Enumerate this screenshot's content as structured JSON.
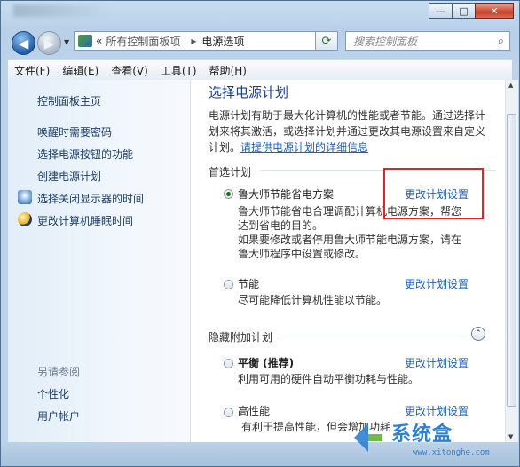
{
  "window": {
    "caption_minimize": "—",
    "caption_maximize": "□",
    "caption_close": "✕"
  },
  "nav": {
    "back_glyph": "◀",
    "forward_glyph": "▶",
    "history_glyph": "▼",
    "address": {
      "sep": "«",
      "crumb1": "所有控制面板项",
      "arrow": "▸",
      "crumb2": "电源选项",
      "dropdown_glyph": "▼"
    },
    "refresh_glyph": "⟳",
    "search_placeholder": "搜索控制面板",
    "search_icon_glyph": "⌕"
  },
  "menu": [
    "文件(F)",
    "编辑(E)",
    "查看(V)",
    "工具(T)",
    "帮助(H)"
  ],
  "sidebar": {
    "home": "控制面板主页",
    "links": [
      "唤醒时需要密码",
      "选择电源按钮的功能",
      "创建电源计划",
      "选择关闭显示器的时间",
      "更改计算机睡眠时间"
    ],
    "see_also": "另请参阅",
    "see_also_links": [
      "个性化",
      "用户帐户"
    ]
  },
  "main": {
    "title": "选择电源计划",
    "intro_l1": "电源计划有助于最大化计算机的性能或者节能。通过选择计",
    "intro_l2": "划来将其激活，或选择计划并通过更改其电源设置来自定义",
    "intro_l3_pre": "计划。",
    "intro_link": "请提供电源计划的详细信息",
    "preferred_header": "首选计划",
    "hidden_header": "隐藏附加计划",
    "chevron_glyph": "⌃",
    "change_settings": "更改计划设置",
    "plans": [
      {
        "name": "鲁大师节能省电方案",
        "selected": true,
        "desc_lines": [
          "鲁大师节能省电合理调配计算机电源方案，帮您",
          "达到省电的目的。",
          "如果要修改或者停用鲁大师节能电源方案，请在",
          "鲁大师程序中设置或修改。"
        ]
      },
      {
        "name": "节能",
        "selected": false,
        "desc_lines": [
          "尽可能降低计算机性能以节能。"
        ]
      },
      {
        "name": "平衡 (推荐)",
        "selected": false,
        "desc_lines": [
          "利用可用的硬件自动平衡功耗与性能。"
        ]
      },
      {
        "name": "高性能",
        "selected": false,
        "desc_lines": [
          "有利于提高性能，但会增加功耗"
        ]
      }
    ]
  },
  "watermark": {
    "text": "系统盒",
    "url": "www.xitonghe.com",
    "colors": {
      "brand": "#2f7fd1"
    }
  },
  "colors": {
    "link": "#1f5fb5",
    "title": "#1a3d8a",
    "highlight_box": "#e0242b"
  }
}
